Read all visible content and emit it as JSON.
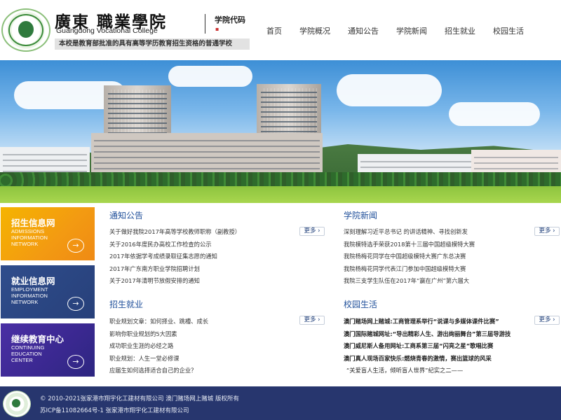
{
  "header": {
    "school_name": "廣東  職業學院",
    "school_name_en": "Guangdong  Vocational College",
    "code_label": "学院代码",
    "slogan": "本校是教育部批准的具有高等学历教育招生资格的普通学校"
  },
  "nav": {
    "items": [
      "首页",
      "学院概况",
      "通知公告",
      "学院新闻",
      "招生就业",
      "校园生活"
    ]
  },
  "sidebar": {
    "admission": {
      "title": "招生信息网",
      "en": "ADMISSIONS\nINFORMATION\nNETWORK",
      "arrow": "→"
    },
    "employment": {
      "title": "就业信息网",
      "en": "EMPLOYMENT\nINFORMATION\nNETWORK",
      "arrow": "→"
    },
    "continuing": {
      "title": "继续教育中心",
      "en": "CONTINUING\nEDUCATION\nCENTER",
      "arrow": "→"
    }
  },
  "more_label": "更多 ›",
  "notices": {
    "title": "通知公告",
    "items": [
      "关于做好我院2017年高等学校教师职称（副教授）",
      "关于2016年度民办高校工作检查的公示",
      "2017年依据学考成绩录取征集志愿的通知",
      "2017年广东南方职业学院招聘计划",
      "关于2017年清明节放假安排的通知"
    ]
  },
  "news": {
    "title": "学院新闻",
    "items": [
      "深刻理解习近平总书记 的讲话精神、寻找创新发",
      "我院模特选手荣获2018第十三届中国超级模特大赛",
      "我院杨梅花同学在中国超级模特大赛广东总决赛",
      "我院杨梅花同学代表江门参加中国超级模特大赛",
      "我院三支学生队伍在2017年“赢在广州”第六届大"
    ]
  },
  "employment": {
    "title": "招生就业",
    "items": [
      "职业规划文章：如何择业、跳槽、成长",
      "影响你职业规划的5大因素",
      "成功职业生涯的必经之路",
      "职业规划：人生一堂必修课",
      "应届生如何选择适合自己的企业？"
    ]
  },
  "campus": {
    "title": "校园生活",
    "items": [
      "澳门赌场网上赌城:工商管理系举行“说课与多媒体课件比赛”",
      "澳门国际赌城网址:“导出精彩人生、游出绚丽舞台”第三届导游技",
      "澳门威尼斯人备用网址:工商系第三届“闪亮之星”歌唱比赛",
      "澳门真人现场百家快乐:燃烧青春的激情，赛出篮球的风采",
      "“关爱盲人生活，倾听盲人世界”纪实之二——"
    ]
  },
  "footer": {
    "line1": "© 2010-2021张家港市翔宇化工建材有限公司 澳门赌场网上赌城 版权所有",
    "line2": "苏ICP备11082664号-1 张家港市翔宇化工建材有限公司"
  },
  "colors": {
    "accent_blue": "#1f4f9a",
    "footer_bg": "#27366e",
    "admission_orange": "#f39a12",
    "employment_navy": "#2f4d8c",
    "continuing_purple": "#3a2890"
  }
}
